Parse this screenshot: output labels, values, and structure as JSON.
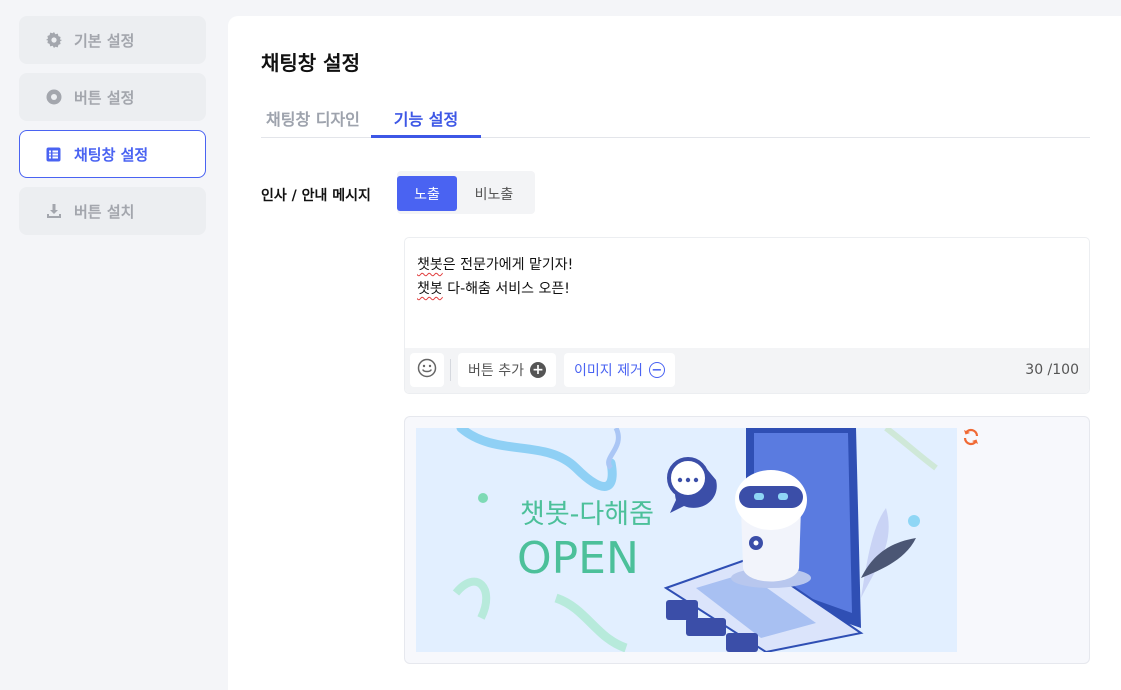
{
  "sidebar": {
    "items": [
      {
        "label": "기본 설정",
        "icon": "gear-icon",
        "active": false
      },
      {
        "label": "버튼 설정",
        "icon": "record-circle-icon",
        "active": false
      },
      {
        "label": "채팅창 설정",
        "icon": "list-icon",
        "active": true
      },
      {
        "label": "버튼 설치",
        "icon": "download-icon",
        "active": false
      }
    ]
  },
  "main": {
    "title": "채팅창 설정",
    "tabs": [
      {
        "label": "채팅창 디자인",
        "active": false
      },
      {
        "label": "기능 설정",
        "active": true
      }
    ],
    "greeting": {
      "label": "인사 / 안내 메시지",
      "toggle_on": "노출",
      "toggle_off": "비노출",
      "selected": "노출"
    },
    "editor": {
      "line1_a": "챗봇",
      "line1_b": "은 전문가에게 맡기자!",
      "line2_a": "챗봇",
      "line2_b": " 다-해춤 서비스 오픈!",
      "add_button": "버튼 추가",
      "remove_image": "이미지 제거",
      "counter": "30 /100"
    },
    "image": {
      "headline": "챗봇-다해줌",
      "subline": "OPEN"
    }
  },
  "colors": {
    "accent": "#4a63f2",
    "refresh": "#f06a35",
    "banner_text": "#4cc09a"
  }
}
